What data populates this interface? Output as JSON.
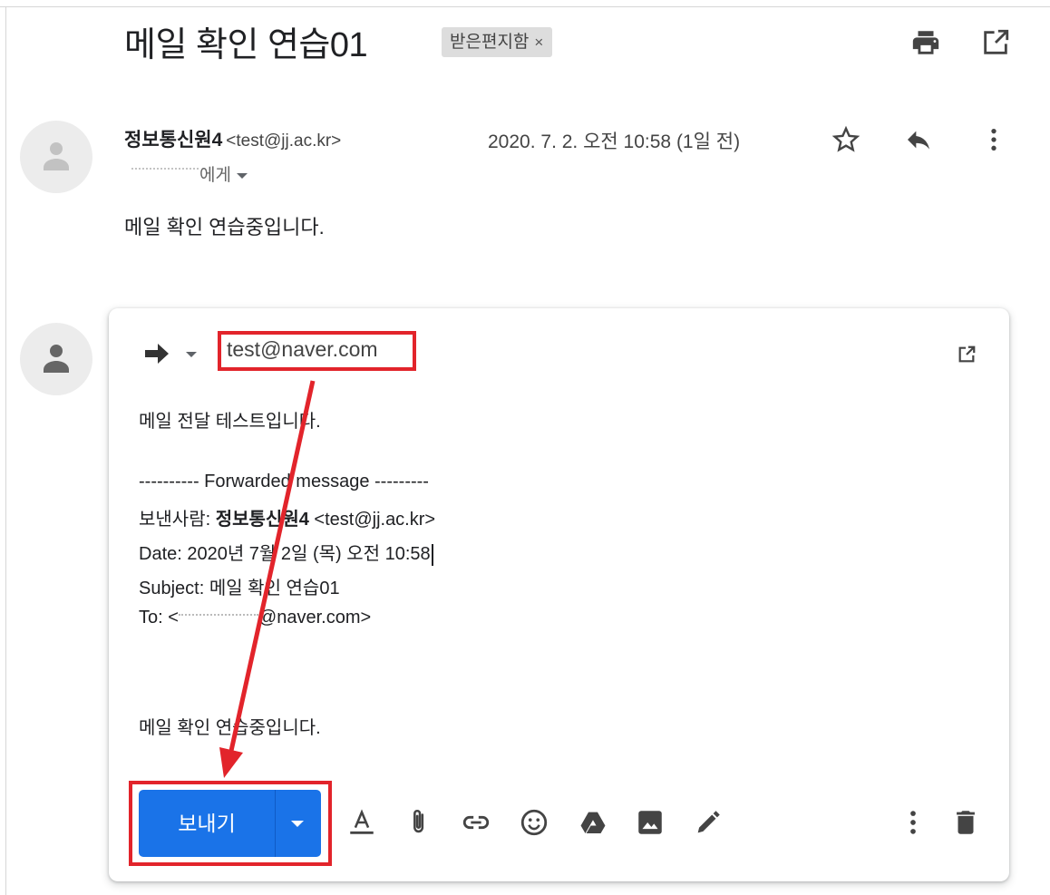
{
  "header": {
    "subject": "메일 확인 연습01",
    "label_chip": "받은편지함",
    "label_chip_close": "×",
    "icons": [
      "print-icon",
      "open-in-new-window-icon"
    ]
  },
  "message": {
    "sender_name": "정보통신원4",
    "sender_email": "<test@jj.ac.kr>",
    "date": "2020. 7. 2. 오전 10:58 (1일 전)",
    "to_suffix": "에게",
    "body": "메일 확인 연습중입니다.",
    "action_icons": [
      "star-icon",
      "reply-icon",
      "more-vert-icon"
    ]
  },
  "compose": {
    "recipient": "test@naver.com",
    "intro": "메일 전달 테스트입니다.",
    "forwarded_header": "---------- Forwarded message ---------",
    "from_label": "보낸사람: ",
    "from_name": "정보통신원4",
    "from_email": " <test@jj.ac.kr>",
    "date_line": "Date: 2020년 7월 2일 (목) 오전 10:58",
    "subject_line": "Subject: 메일 확인 연습01",
    "to_prefix": "To: <",
    "to_domain": "@naver.com>",
    "quoted_body": "메일 확인 연습중입니다.",
    "send_label": "보내기",
    "toolbar_icons": [
      "format-text-icon",
      "attach-icon",
      "link-icon",
      "emoji-icon",
      "drive-icon",
      "photo-icon",
      "signature-icon",
      "more-options-icon",
      "delete-icon"
    ]
  },
  "annotations": {
    "highlight_color": "#e2242b",
    "accent_color": "#1a73e8"
  }
}
